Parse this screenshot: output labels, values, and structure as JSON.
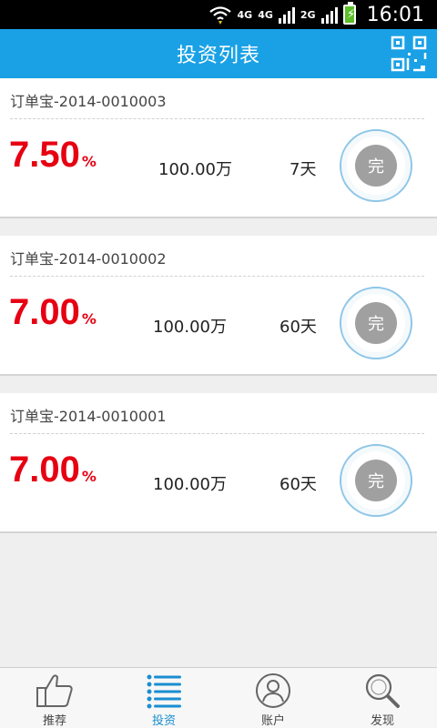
{
  "statusbar": {
    "net1": "4G",
    "net2": "4G",
    "net3": "2G",
    "time": "16:01"
  },
  "header": {
    "title": "投资列表"
  },
  "items": [
    {
      "title": "订单宝-2014-0010003",
      "rate": "7.50",
      "rate_unit": "%",
      "amount": "100.00万",
      "days": "7天",
      "status": "完"
    },
    {
      "title": "订单宝-2014-0010002",
      "rate": "7.00",
      "rate_unit": "%",
      "amount": "100.00万",
      "days": "60天",
      "status": "完"
    },
    {
      "title": "订单宝-2014-0010001",
      "rate": "7.00",
      "rate_unit": "%",
      "amount": "100.00万",
      "days": "60天",
      "status": "完"
    }
  ],
  "tabs": [
    {
      "label": "推荐",
      "icon": "thumbs-up-icon"
    },
    {
      "label": "投资",
      "icon": "list-icon",
      "active": true
    },
    {
      "label": "账户",
      "icon": "user-icon"
    },
    {
      "label": "发现",
      "icon": "search-icon"
    }
  ],
  "colors": {
    "header": "#1aa1e5",
    "rate": "#e60012",
    "active_tab": "#1a8ed0"
  }
}
